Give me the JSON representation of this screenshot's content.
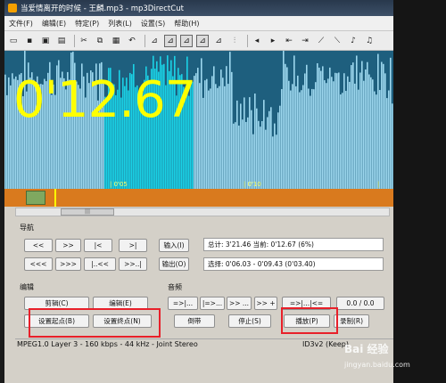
{
  "window": {
    "title": "当爱情离开的时候 - 王麟.mp3 - mp3DirectCut"
  },
  "menu": [
    "文件(F)",
    "编辑(E)",
    "特定(P)",
    "列表(L)",
    "设置(S)",
    "帮助(H)"
  ],
  "toolbar_icons": [
    "new-icon",
    "save-icon",
    "save-as-icon",
    "save-all-icon",
    "cut-icon",
    "copy-icon",
    "paste-icon",
    "undo-icon",
    "peak-icon",
    "cue-icon",
    "cue-active-icon",
    "cue-split-icon",
    "marker-icon",
    "level-icon",
    "prev-cue-icon",
    "next-cue-icon",
    "begin-icon",
    "end-icon",
    "fade-in-icon",
    "fade-out-icon",
    "normalize-icon",
    "volume-icon"
  ],
  "wave": {
    "time": "0'12.67",
    "ticks": [
      "| 0'05",
      "| 0'10",
      "| 0'15"
    ],
    "colors": {
      "background": "#1e5f7e",
      "wave": "#9dd7ee",
      "selected": "#1ad2e6",
      "time": "#ffff00"
    }
  },
  "nav": {
    "title": "导航",
    "row1": [
      "<<",
      ">>",
      "|<",
      ">|"
    ],
    "row2": [
      "<<<",
      ">>>",
      "|..<<",
      ">>..|"
    ],
    "in_btn": "输入(I)",
    "out_btn": "输出(O)",
    "total_line": "总计: 3'21.46   当前: 0'12.67  (6%)",
    "selection_line": "选择: 0'06.03 - 0'09.43 (0'03.40)"
  },
  "edit": {
    "title": "编辑",
    "cut": "剪辑(C)",
    "edit": "编辑(E)",
    "set_start": "设置起点(B)",
    "set_end": "设置终点(N)"
  },
  "audio": {
    "title": "音频",
    "row1": [
      "=>|...",
      "|=>...",
      ">> ...",
      ">> +",
      "=>|...|<=",
      "0.0 / 0.0"
    ],
    "rewind": "倒带",
    "stop": "停止(S)",
    "play": "播放(P)",
    "record": "录制(R)"
  },
  "status": {
    "left": "MPEG1.0 Layer 3 - 160 kbps - 44 kHz - Joint Stereo",
    "right": "ID3v2 (Keep)"
  },
  "watermark": {
    "text": "Bai 经验",
    "url": "jingyan.baidu.com"
  }
}
